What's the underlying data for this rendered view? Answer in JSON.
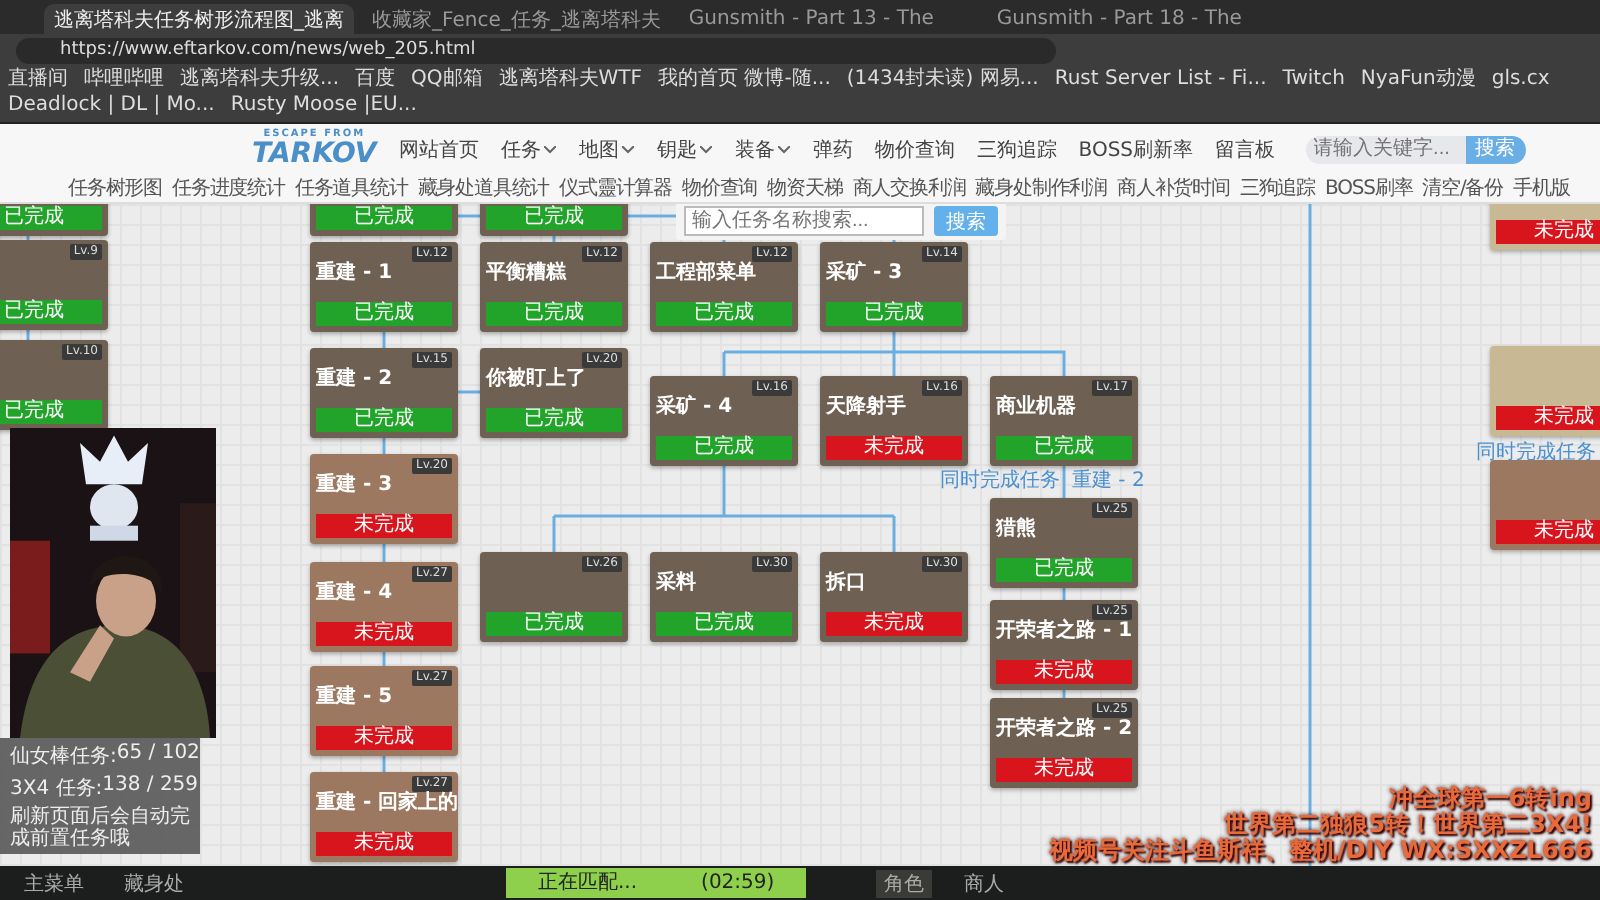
{
  "browser": {
    "tabs": [
      {
        "title": "逃离塔科夫任务树形流程图_逃离",
        "selected": true
      },
      {
        "title": "收藏家_Fence_任务_逃离塔科夫",
        "selected": false
      },
      {
        "title": "Gunsmith - Part 13 - The",
        "selected": false
      },
      {
        "title": "Gunsmith - Part 18 - The",
        "selected": false
      }
    ],
    "address": "https://www.eftarkov.com/news/web_205.html",
    "bookmarks": [
      "直播间",
      "哔哩哔哩",
      "逃离塔科夫升级...",
      "百度",
      "QQ邮箱",
      "逃离塔科夫WTF",
      "我的首页 微博-随...",
      "(1434封未读) 网易...",
      "Rust Server List - Fi...",
      "Twitch",
      "NyaFun动漫",
      "gls.cx",
      "Deadlock | DL | Mo...",
      "Rusty Moose |EU..."
    ]
  },
  "site": {
    "logo_top": "ESCAPE FROM",
    "logo": "TARKOV",
    "nav": [
      {
        "label": "网站首页",
        "dropdown": false
      },
      {
        "label": "任务",
        "dropdown": true
      },
      {
        "label": "地图",
        "dropdown": true
      },
      {
        "label": "钥匙",
        "dropdown": true
      },
      {
        "label": "装备",
        "dropdown": true
      },
      {
        "label": "弹药",
        "dropdown": false
      },
      {
        "label": "物价查询",
        "dropdown": false
      },
      {
        "label": "三狗追踪",
        "dropdown": false
      },
      {
        "label": "BOSS刷新率",
        "dropdown": false
      },
      {
        "label": "留言板",
        "dropdown": false
      }
    ],
    "search": {
      "placeholder": "请输入关键字...",
      "button": "搜索"
    },
    "subnav": [
      "任务树形图",
      "任务进度统计",
      "任务道具统计",
      "藏身处道具统计",
      "仪式靈计算器",
      "物价查询",
      "物资天梯",
      "商人交换利润",
      "藏身处制作利润",
      "商人补货时间",
      "三狗追踪",
      "BOSS刷率",
      "清空/备份",
      "手机版"
    ]
  },
  "tree": {
    "search": {
      "placeholder": "输入任务名称搜索...",
      "button": "搜索"
    },
    "quests": [
      {
        "completed": true,
        "status": "已完成",
        "color": "#6e6052"
      },
      {
        "completed": true,
        "status": "已完成",
        "color": "#6e6052"
      },
      {
        "completed": true,
        "status": "已完成",
        "color": "#6e6052"
      },
      {
        "completed": false,
        "status": "未完成",
        "color": "#c8b994"
      },
      {
        "level": "Lv.9",
        "completed": true,
        "status": "已完成",
        "color": "#6e6052"
      },
      {
        "title": "重建 - 1",
        "level": "Lv.12",
        "completed": true,
        "status": "已完成",
        "color": "#6e6052"
      },
      {
        "title": "平衡糟糕",
        "level": "Lv.12",
        "completed": true,
        "status": "已完成",
        "color": "#6e6052"
      },
      {
        "title": "工程部菜单",
        "level": "Lv.12",
        "completed": true,
        "status": "已完成",
        "color": "#6e6052"
      },
      {
        "title": "采矿 - 3",
        "level": "Lv.14",
        "completed": true,
        "status": "已完成",
        "color": "#6e6052"
      },
      {
        "level": "Lv.10",
        "completed": true,
        "status": "已完成",
        "color": "#6e6052"
      },
      {
        "title": "重建 - 2",
        "level": "Lv.15",
        "completed": true,
        "status": "已完成",
        "color": "#6e6052"
      },
      {
        "title": "你被盯上了",
        "level": "Lv.20",
        "completed": true,
        "status": "已完成",
        "color": "#6e6052"
      },
      {
        "title": "采矿 - 4",
        "level": "Lv.16",
        "completed": true,
        "status": "已完成",
        "color": "#6e6052"
      },
      {
        "title": "天降射手",
        "level": "Lv.16",
        "completed": false,
        "status": "未完成",
        "color": "#6e6052"
      },
      {
        "title": "商业机器",
        "level": "Lv.17",
        "completed": true,
        "status": "已完成",
        "color": "#6e6052"
      },
      {
        "completed": false,
        "status": "未完成",
        "color": "#c8b994"
      },
      {
        "title": "重建 - 3",
        "level": "Lv.20",
        "completed": false,
        "status": "未完成",
        "color": "#9c7860"
      },
      {
        "completed": false,
        "status": "未完成",
        "color": "#9c7860"
      },
      {
        "title": "猎熊",
        "level": "Lv.25",
        "completed": true,
        "status": "已完成",
        "color": "#6e6052"
      },
      {
        "level": "Lv.26",
        "completed": true,
        "status": "已完成",
        "color": "#6e6052"
      },
      {
        "title": "采料",
        "level": "Lv.30",
        "completed": true,
        "status": "已完成",
        "color": "#6e6052"
      },
      {
        "title": "拆口",
        "level": "Lv.30",
        "completed": false,
        "status": "未完成",
        "color": "#6e6052"
      },
      {
        "title": "重建 - 4",
        "level": "Lv.27",
        "completed": false,
        "status": "未完成",
        "color": "#9c7860"
      },
      {
        "title": "开荣者之路 - 1",
        "level": "Lv.25",
        "completed": false,
        "status": "未完成",
        "color": "#6e6052"
      },
      {
        "title": "重建 - 5",
        "level": "Lv.27",
        "completed": false,
        "status": "未完成",
        "color": "#9c7860"
      },
      {
        "title": "开荣者之路 - 2",
        "level": "Lv.25",
        "completed": false,
        "status": "未完成",
        "color": "#6e6052"
      },
      {
        "title": "重建 - 回家上的",
        "level": "Lv.27",
        "completed": false,
        "status": "未完成",
        "color": "#9c7860"
      }
    ],
    "links": [
      {
        "label": "同时完成任务",
        "target": "重建 - 2"
      },
      {
        "label": "同时完成任务"
      }
    ]
  },
  "stats": [
    {
      "label": "仙女棒任务:",
      "value": "65 / 102"
    },
    {
      "label": "3X4 任务:",
      "value": "138 / 259"
    }
  ],
  "stats_note": "刷新页面后会自动完成前置任务哦",
  "game_bar": {
    "items": [
      {
        "label": "主菜单",
        "selected": false
      },
      {
        "label": "藏身处",
        "selected": false
      },
      {
        "label": "角色",
        "selected": true
      },
      {
        "label": "商人",
        "selected": false
      }
    ],
    "matching": "正在匹配...",
    "timer": "(02:59)"
  },
  "overlay_lines": [
    "冲全球第一6转ing",
    "世界第二独狼5转！世界第二3X4!",
    "视频号关注斗鱼斯祥、整机/DIY WX:SXXZL666"
  ]
}
